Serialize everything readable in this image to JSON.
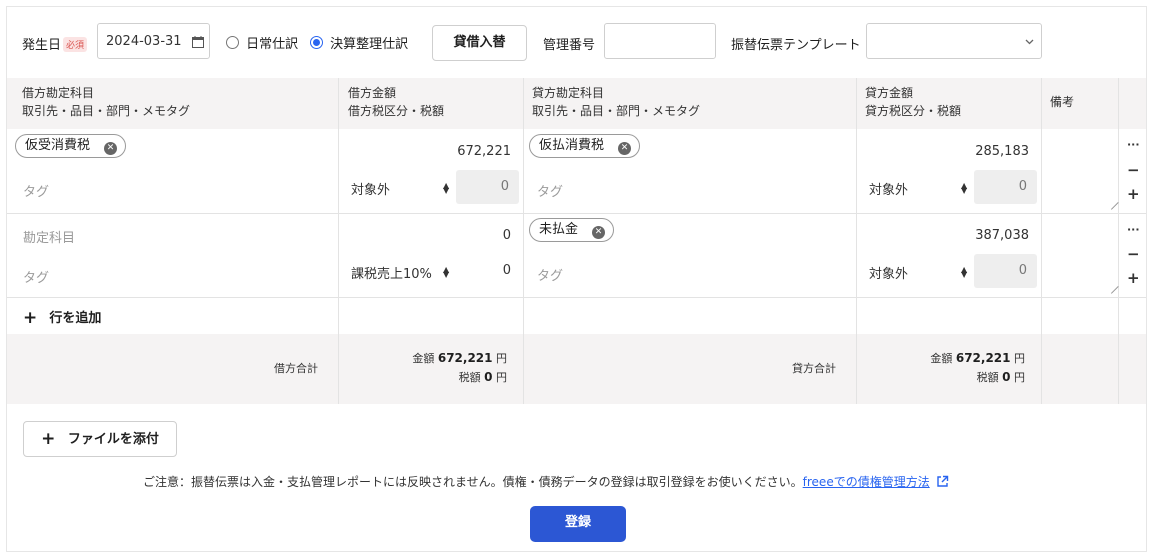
{
  "top": {
    "date_label": "発生日",
    "required_badge": "必須",
    "date_value": "2024-03-31",
    "radio_normal": "日常仕訳",
    "radio_closing": "決算整理仕訳",
    "swap_button": "貸借入替",
    "mgmt_label": "管理番号",
    "mgmt_value": "",
    "template_label": "振替伝票テンプレート",
    "template_value": ""
  },
  "headers": {
    "debit_account_1": "借方勘定科目",
    "debit_account_2": "取引先・品目・部門・メモタグ",
    "debit_amount_1": "借方金額",
    "debit_amount_2": "借方税区分・税額",
    "credit_account_1": "貸方勘定科目",
    "credit_account_2": "取引先・品目・部門・メモタグ",
    "credit_amount_1": "貸方金額",
    "credit_amount_2": "貸方税区分・税額",
    "remarks": "備考"
  },
  "rows": [
    {
      "debit_account": "仮受消費税",
      "debit_tag_ph": "タグ",
      "debit_amount": "672,221",
      "debit_tax_type": "対象外",
      "debit_tax": "0",
      "credit_account": "仮払消費税",
      "credit_tag_ph": "タグ",
      "credit_amount": "285,183",
      "credit_tax_type": "対象外",
      "credit_tax": "0"
    },
    {
      "debit_account_ph": "勘定科目",
      "debit_tag_ph": "タグ",
      "debit_amount": "0",
      "debit_tax_type": "課税売上10%",
      "debit_tax": "0",
      "credit_account": "未払金",
      "credit_tag_ph": "タグ",
      "credit_amount": "387,038",
      "credit_tax_type": "対象外",
      "credit_tax": "0"
    }
  ],
  "row_controls": {
    "more": "···",
    "remove": "−",
    "add": "+"
  },
  "add_row": {
    "icon": "+",
    "label": "行を追加"
  },
  "totals": {
    "debit_label": "借方合計",
    "credit_label": "貸方合計",
    "amount_label": "金額",
    "tax_label": "税額",
    "debit_amount": "672,221",
    "debit_tax": "0",
    "credit_amount": "672,221",
    "credit_tax": "0",
    "yen": "円"
  },
  "attach": {
    "icon": "+",
    "label": "ファイルを添付"
  },
  "notice": {
    "text": "ご注意：振替伝票は入金・支払管理レポートには反映されません。債権・債務データの登録は取引登録をお使いください。",
    "link": "freeeでの債権管理方法"
  },
  "submit": "登録",
  "colors": {
    "primary": "#2c57d4",
    "link": "#2864f0",
    "header_bg": "#f5f3f3"
  }
}
